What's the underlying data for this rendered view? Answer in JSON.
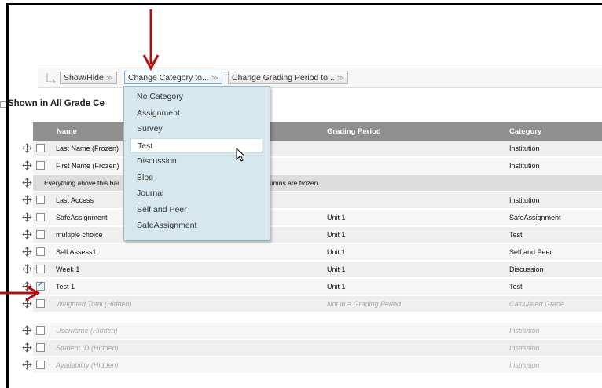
{
  "toolbar": {
    "show_hide": "Show/Hide",
    "change_category": "Change Category to...",
    "change_grading_period": "Change Grading Period to..."
  },
  "section_title": "Shown in All Grade Ce",
  "columns": {
    "name": "Name",
    "grading_period": "Grading Period",
    "category": "Category"
  },
  "dropdown": {
    "items": [
      "No Category",
      "Assignment",
      "Survey",
      "Test",
      "Discussion",
      "Blog",
      "Journal",
      "Self and Peer",
      "SafeAssignment"
    ],
    "highlighted": "Test"
  },
  "frozen_note": {
    "left": "Everything above this bar",
    "right": "which columns are frozen."
  },
  "rows": [
    {
      "name": "Last Name (Frozen)",
      "period": "",
      "category": "Institution",
      "checked": false,
      "hidden": false
    },
    {
      "name": "First Name (Frozen)",
      "period": "",
      "category": "Institution",
      "checked": false,
      "hidden": false
    },
    {
      "name": "Last Access",
      "period": "",
      "category": "Institution",
      "checked": false,
      "hidden": false
    },
    {
      "name": "SafeAssignment",
      "period": "Unit 1",
      "category": "SafeAssignment",
      "checked": false,
      "hidden": false
    },
    {
      "name": "multiple choice",
      "period": "Unit 1",
      "category": "Test",
      "checked": false,
      "hidden": false
    },
    {
      "name": "Self Assess1",
      "period": "Unit 1",
      "category": "Self and Peer",
      "checked": false,
      "hidden": false
    },
    {
      "name": "Week 1",
      "period": "Unit 1",
      "category": "Discussion",
      "checked": false,
      "hidden": false
    },
    {
      "name": "Test 1",
      "period": "Unit 1",
      "category": "Test",
      "checked": true,
      "hidden": false
    },
    {
      "name": "Weighted Total (Hidden)",
      "period": "Not in a Grading Period",
      "category": "Calculated Grade",
      "checked": false,
      "hidden": true
    },
    {
      "name": "Username (Hidden)",
      "period": "",
      "category": "Institution",
      "checked": false,
      "hidden": true
    },
    {
      "name": "Student ID (Hidden)",
      "period": "",
      "category": "Institution",
      "checked": false,
      "hidden": true
    },
    {
      "name": "Availability (Hidden)",
      "period": "",
      "category": "Institution",
      "checked": false,
      "hidden": true
    }
  ],
  "colors": {
    "annotation_arrow": "#b01010",
    "header_bg": "#8f8f8f",
    "dropdown_bg": "#d6e8ee"
  }
}
